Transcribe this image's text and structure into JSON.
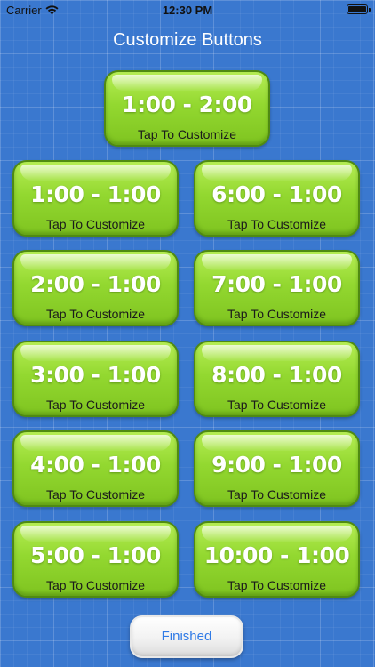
{
  "status_bar": {
    "carrier": "Carrier",
    "time": "12:30 PM"
  },
  "header": {
    "title": "Customize Buttons"
  },
  "buttons": [
    {
      "time": "1:00 - 2:00",
      "caption": "Tap To Customize"
    },
    {
      "time": "1:00 - 1:00",
      "caption": "Tap To Customize"
    },
    {
      "time": "6:00 - 1:00",
      "caption": "Tap To Customize"
    },
    {
      "time": "2:00 - 1:00",
      "caption": "Tap To Customize"
    },
    {
      "time": "7:00 - 1:00",
      "caption": "Tap To Customize"
    },
    {
      "time": "3:00 - 1:00",
      "caption": "Tap To Customize"
    },
    {
      "time": "8:00 - 1:00",
      "caption": "Tap To Customize"
    },
    {
      "time": "4:00 - 1:00",
      "caption": "Tap To Customize"
    },
    {
      "time": "9:00 - 1:00",
      "caption": "Tap To Customize"
    },
    {
      "time": "5:00 - 1:00",
      "caption": "Tap To Customize"
    },
    {
      "time": "10:00 - 1:00",
      "caption": "Tap To Customize"
    }
  ],
  "footer": {
    "finished_label": "Finished"
  },
  "colors": {
    "background": "#3a78cf",
    "button_green": "#93d830",
    "finished_text": "#2f7ae6"
  }
}
